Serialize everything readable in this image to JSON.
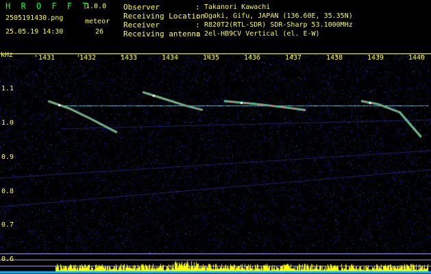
{
  "app": {
    "title": "H R O F F T",
    "version": "1.0.0",
    "file_name": "2505191430.png",
    "timestamp": "25.05.19 14:30",
    "meteor_label": "meteor",
    "meteor_count": "26"
  },
  "info": [
    {
      "key": "Observer",
      "value": "Takanori Kawachi"
    },
    {
      "key": "Receiving Location",
      "value": "Ogaki, Gifu, JAPAN (136.60E, 35.35N)"
    },
    {
      "key": "Receiver",
      "value": "R820T2(RTL-SDR) SDR-Sharp 53.1000MHz"
    },
    {
      "key": "Receiving antenna",
      "value": "2el-HB9CV Vertical (el. E-W)"
    }
  ],
  "spectrogram": {
    "unit_label": "kHz",
    "x_ticks": [
      "1431",
      "1432",
      "1433",
      "1434",
      "1435",
      "1436",
      "1437",
      "1438",
      "1439",
      "1440"
    ],
    "y_ticks": [
      "1.1",
      "1.0",
      "0.9",
      "0.8",
      "0.7",
      "0.6"
    ],
    "x_tick_values": [
      1431,
      1432,
      1433,
      1434,
      1435,
      1436,
      1437,
      1438,
      1439,
      1440
    ],
    "y_tick_values": [
      1.1,
      1.0,
      0.9,
      0.8,
      0.7,
      0.6
    ],
    "xlim": [
      1430.17,
      1440.23
    ],
    "ylim": [
      0.56,
      1.17
    ],
    "carrier_khz": 0.935,
    "echoes": [
      {
        "x": [
          1431.3,
          1431.8,
          1432.3,
          1432.9
        ],
        "y": [
          0.945,
          0.928,
          0.905,
          0.875
        ]
      },
      {
        "x": [
          1433.5,
          1434.0,
          1434.5,
          1434.9
        ],
        "y": [
          0.965,
          0.95,
          0.935,
          0.925
        ]
      },
      {
        "x": [
          1435.4,
          1436.2,
          1436.9,
          1437.3
        ],
        "y": [
          0.945,
          0.938,
          0.93,
          0.925
        ]
      },
      {
        "x": [
          1438.6,
          1439.0,
          1439.5,
          1440.0
        ],
        "y": [
          0.945,
          0.938,
          0.92,
          0.865
        ]
      }
    ],
    "colors": {
      "noise": "#12187a",
      "carrier": "#8fe8ff",
      "echo_core": "#ff3366",
      "echo_mid": "#66ff66",
      "echo_edge": "#00e6e6",
      "guide_lines": "#aab0ff",
      "histogram_fill": "#ffff00",
      "histogram_base": "#00bfff",
      "text": "#ffff33",
      "title": "#00ff44"
    }
  }
}
